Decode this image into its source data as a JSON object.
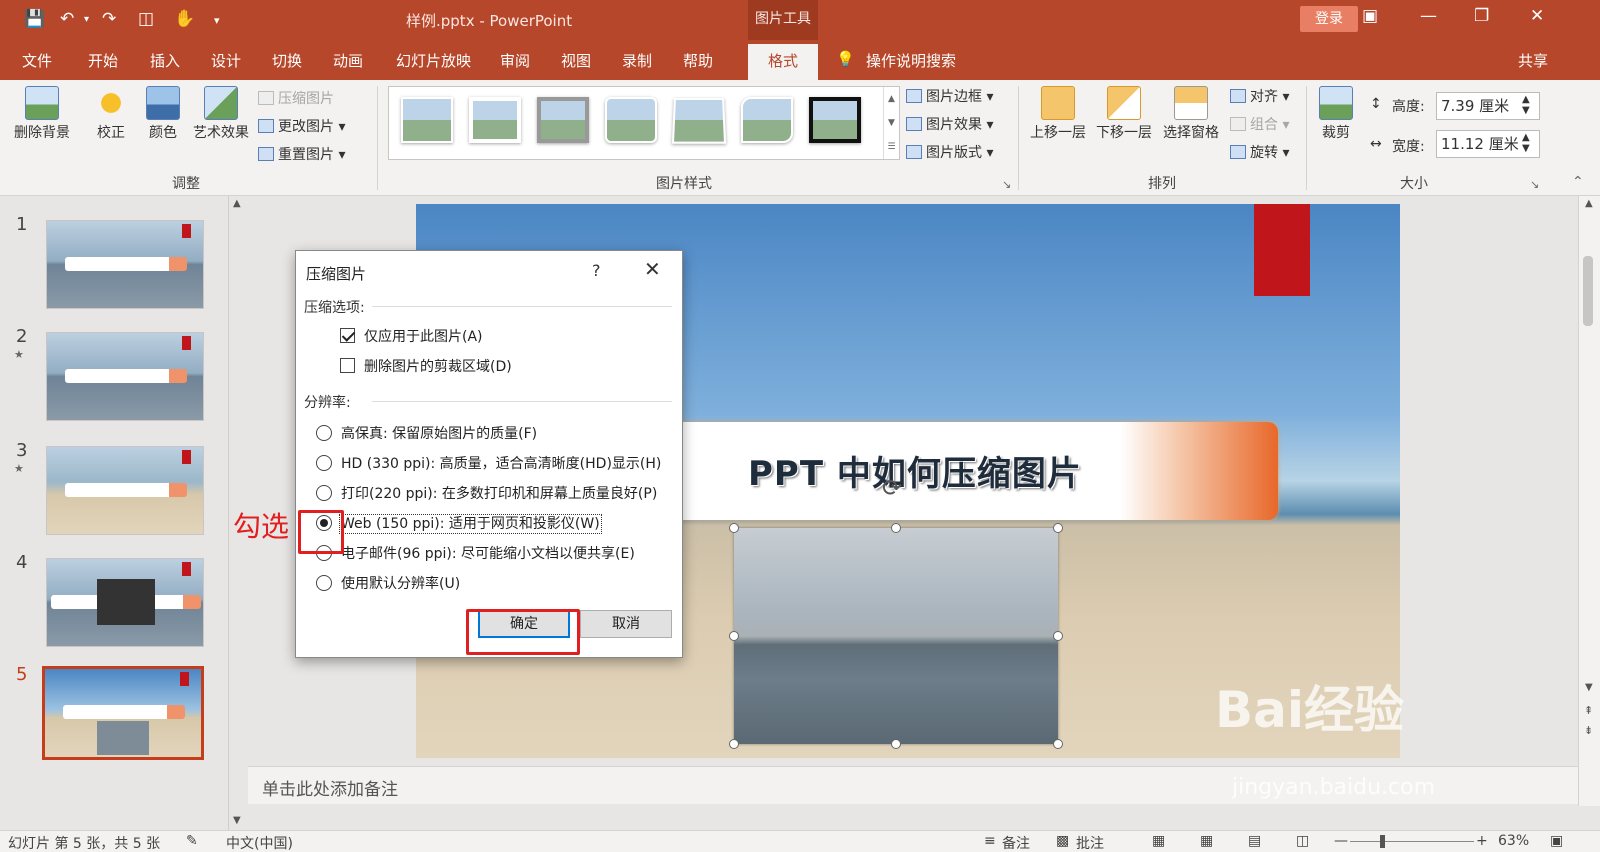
{
  "window": {
    "doc_title": "样例.pptx  -  PowerPoint",
    "context_tab": "图片工具",
    "login": "登录"
  },
  "menu": {
    "tabs": [
      "文件",
      "开始",
      "插入",
      "设计",
      "切换",
      "动画",
      "幻灯片放映",
      "审阅",
      "视图",
      "录制",
      "帮助",
      "格式"
    ],
    "search": "操作说明搜索",
    "share": "共享"
  },
  "ribbon": {
    "adjust": {
      "remove_bg": "删除背景",
      "corrections": "校正",
      "color": "颜色",
      "artistic": "艺术效果",
      "compress": "压缩图片",
      "change": "更改图片",
      "reset": "重置图片",
      "label": "调整"
    },
    "styles": {
      "border": "图片边框",
      "effects": "图片效果",
      "layout": "图片版式",
      "label": "图片样式"
    },
    "arrange": {
      "forward": "上移一层",
      "backward": "下移一层",
      "pane": "选择窗格",
      "align": "对齐",
      "group": "组合",
      "rotate": "旋转",
      "label": "排列"
    },
    "size": {
      "crop": "裁剪",
      "height_label": "高度:",
      "height_value": "7.39 厘米",
      "width_label": "宽度:",
      "width_value": "11.12 厘米",
      "label": "大小"
    }
  },
  "slides": {
    "numbers": [
      "1",
      "2",
      "3",
      "4",
      "5"
    ],
    "active": 5
  },
  "slide": {
    "title": "PPT 中如何压缩图片"
  },
  "notes": {
    "placeholder": "单击此处添加备注"
  },
  "dialog": {
    "title": "压缩图片",
    "help": "?",
    "compress_section": "压缩选项:",
    "apply_only": "仅应用于此图片(A)",
    "apply_only_checked": true,
    "delete_cropped": "删除图片的剪裁区域(D)",
    "delete_cropped_checked": false,
    "resolution_section": "分辨率:",
    "options": [
      "高保真: 保留原始图片的质量(F)",
      "HD (330 ppi): 高质量，适合高清晰度(HD)显示(H)",
      "打印(220 ppi): 在多数打印机和屏幕上质量良好(P)",
      "Web (150 ppi): 适用于网页和投影仪(W)",
      "电子邮件(96 ppi): 尽可能缩小文档以便共享(E)",
      "使用默认分辨率(U)"
    ],
    "selected_option": "Web (150 ppi): 适用于网页和投影仪(W)",
    "ok": "确定",
    "cancel": "取消"
  },
  "annotation": {
    "label": "勾选",
    "color": "#e02020"
  },
  "statusbar": {
    "slide_info": "幻灯片 第 5 张，共 5 张",
    "language": "中文(中国)",
    "notes": "备注",
    "comments": "批注",
    "zoom": "63%"
  },
  "watermark": {
    "brand": "Bai经验",
    "url": "jingyan.baidu.com"
  },
  "colors": {
    "accent": "#b7472a",
    "active_slide": "#c43e1c"
  }
}
